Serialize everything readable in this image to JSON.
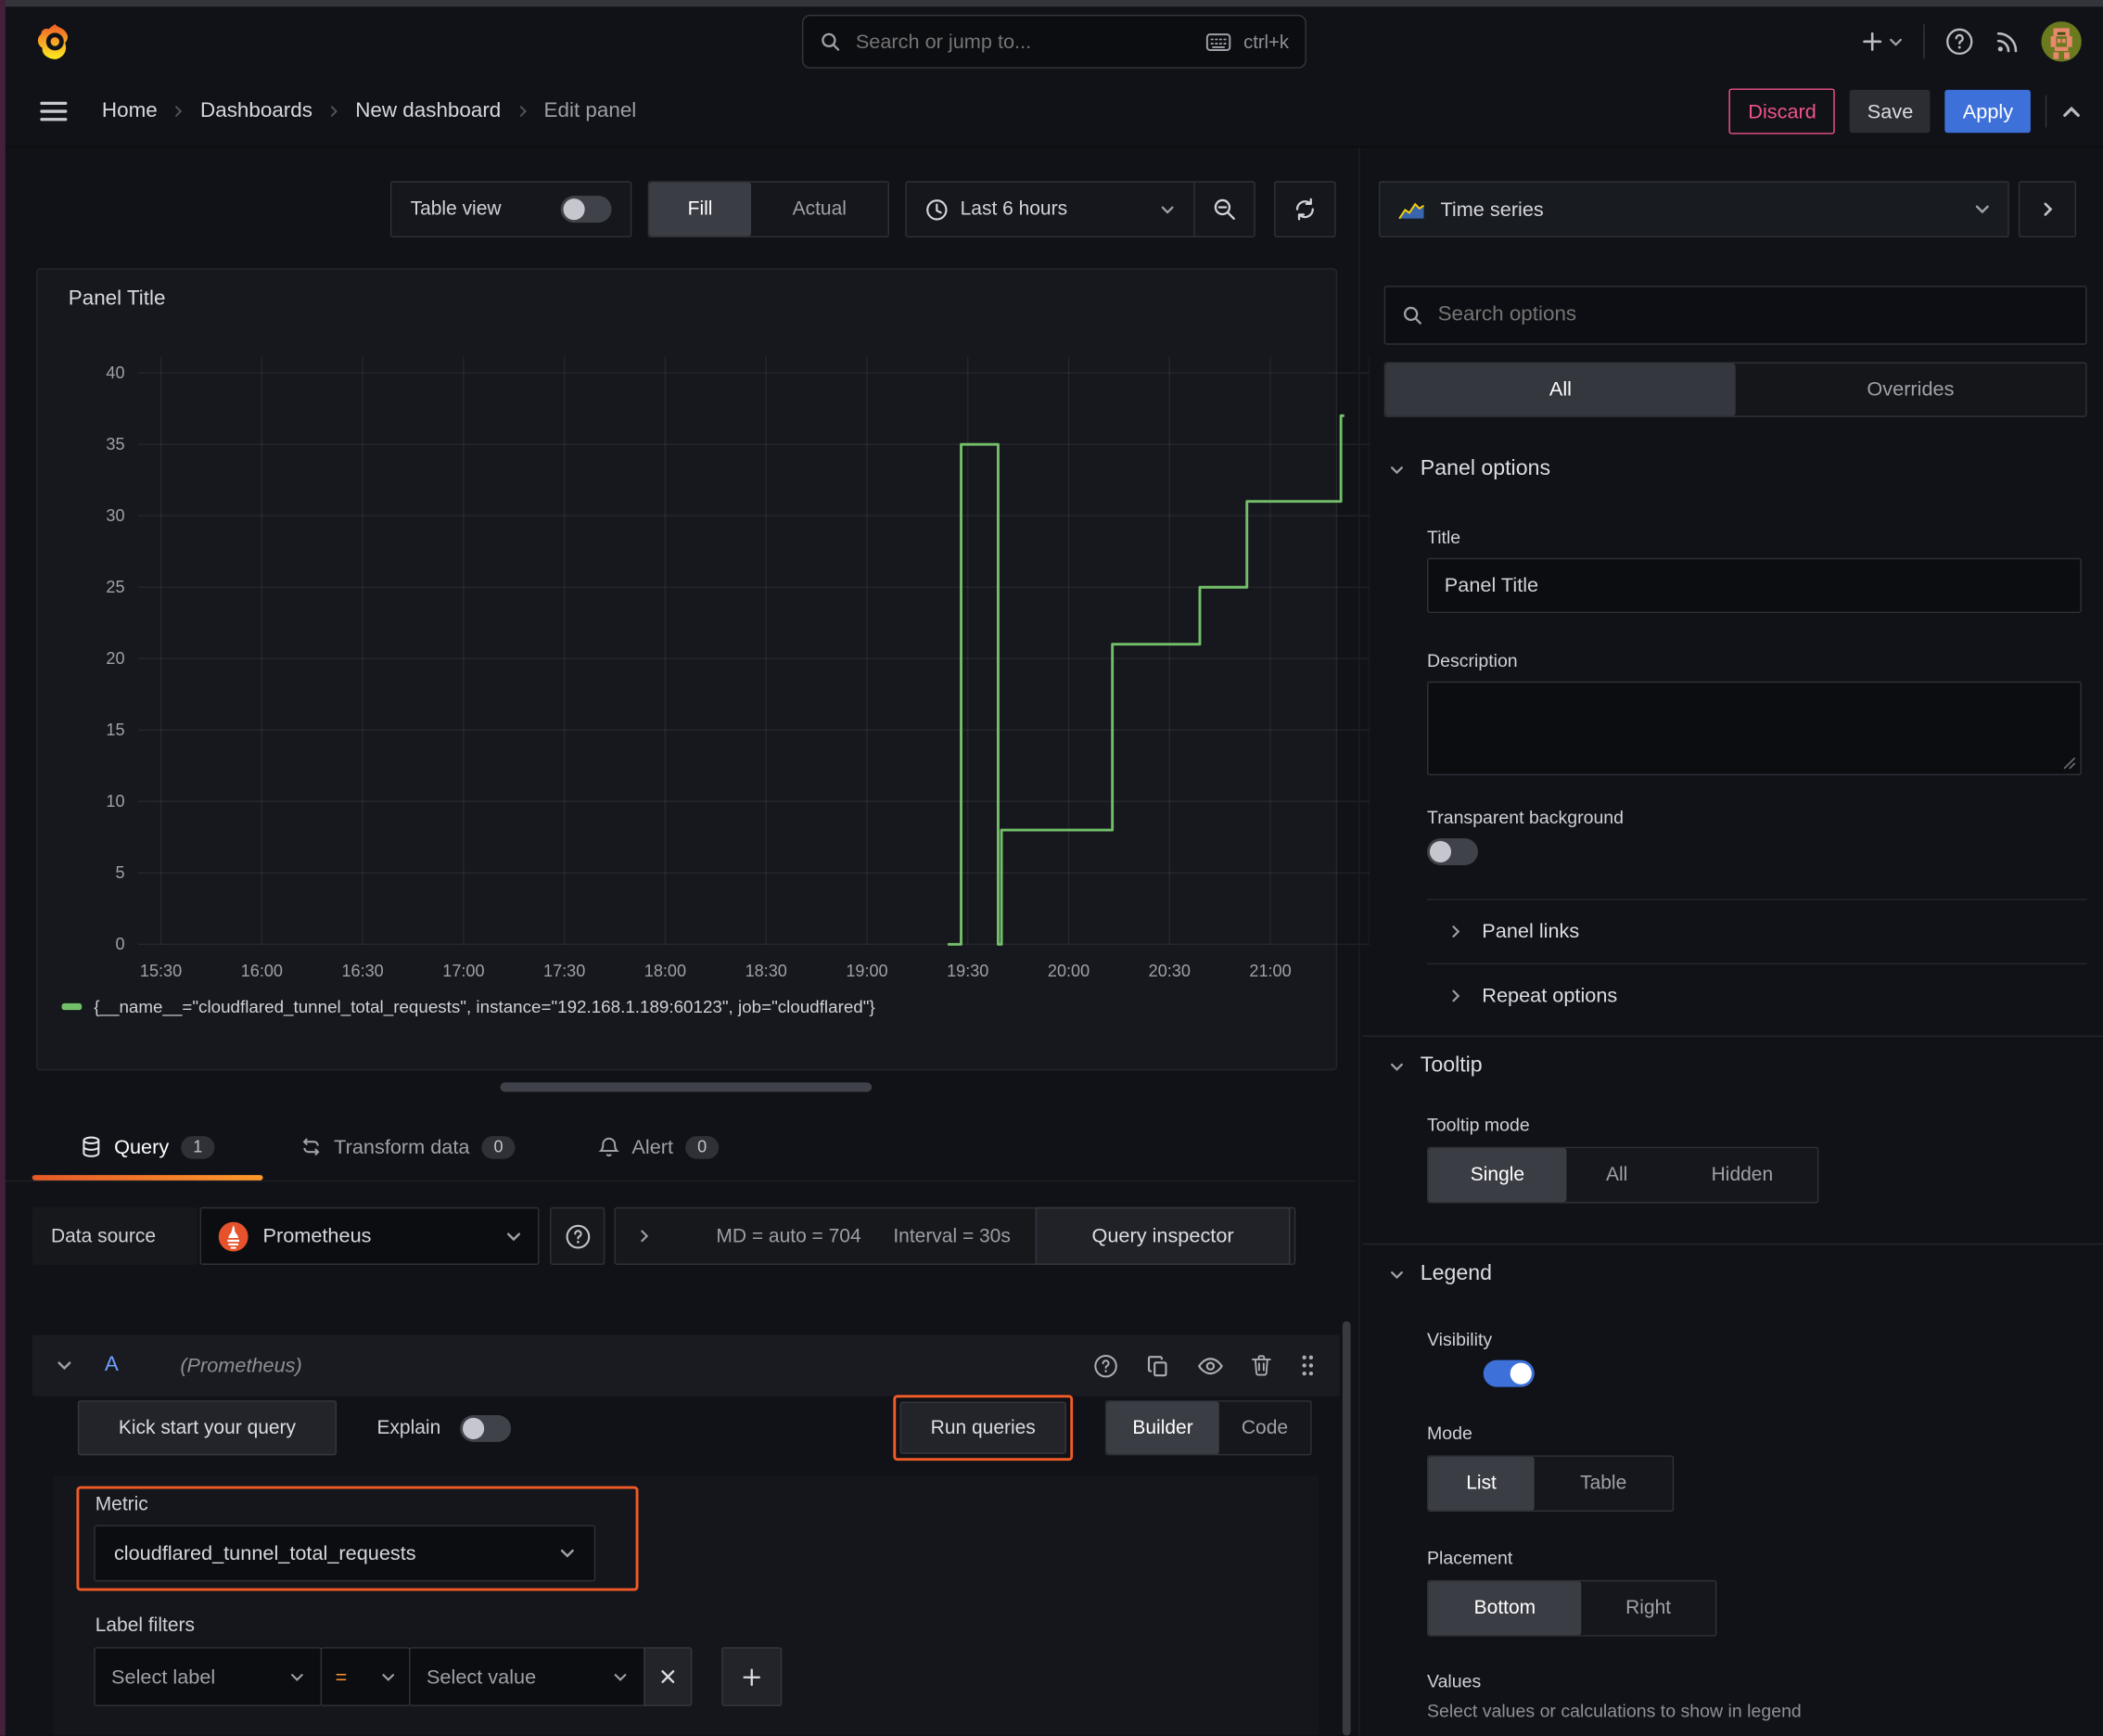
{
  "topbar": {
    "search_placeholder": "Search or jump to...",
    "shortcut": "ctrl+k"
  },
  "breadcrumb": {
    "items": [
      "Home",
      "Dashboards",
      "New dashboard",
      "Edit panel"
    ]
  },
  "actions": {
    "discard": "Discard",
    "save": "Save",
    "apply": "Apply"
  },
  "toolbar": {
    "table_view": "Table view",
    "fill": "Fill",
    "actual": "Actual",
    "time_range": "Last 6 hours"
  },
  "panel": {
    "title": "Panel Title"
  },
  "tabs": {
    "query": "Query",
    "query_count": "1",
    "transform": "Transform data",
    "transform_count": "0",
    "alert": "Alert",
    "alert_count": "0"
  },
  "datasource": {
    "label": "Data source",
    "name": "Prometheus",
    "options_summary": "MD = auto = 704",
    "interval": "Interval = 30s",
    "inspector": "Query inspector"
  },
  "query": {
    "ref_id": "A",
    "ds_hint": "(Prometheus)",
    "kick_start": "Kick start your query",
    "explain": "Explain",
    "run": "Run queries",
    "builder": "Builder",
    "code": "Code",
    "metric_label": "Metric",
    "metric": "cloudflared_tunnel_total_requests",
    "label_filters": "Label filters",
    "select_label": "Select label",
    "operator": "=",
    "select_value": "Select value"
  },
  "options": {
    "viz": "Time series",
    "search_placeholder": "Search options",
    "tab_all": "All",
    "tab_overrides": "Overrides",
    "panel_options": "Panel options",
    "title_label": "Title",
    "title_value": "Panel Title",
    "description_label": "Description",
    "transparent": "Transparent background",
    "panel_links": "Panel links",
    "repeat_options": "Repeat options",
    "tooltip": "Tooltip",
    "tooltip_mode": "Tooltip mode",
    "tooltip_single": "Single",
    "tooltip_all": "All",
    "tooltip_hidden": "Hidden",
    "legend": "Legend",
    "visibility": "Visibility",
    "mode": "Mode",
    "mode_list": "List",
    "mode_table": "Table",
    "placement": "Placement",
    "placement_bottom": "Bottom",
    "placement_right": "Right",
    "values": "Values",
    "values_desc": "Select values or calculations to show in legend"
  },
  "colors": {
    "highlight_orange": "#F15B27",
    "operator_orange": "#FF9830",
    "series_green": "#73BF69",
    "primary_blue": "#3D71D9",
    "discard_pink": "#EF5389",
    "active_tab_gradient": [
      "#E55928",
      "#FF9A2A"
    ]
  },
  "chart_data": {
    "type": "line",
    "title": "Panel Title",
    "x_axis": {
      "unit": "time of day",
      "tick_interval_min": 30,
      "ticks": [
        "15:30",
        "16:00",
        "16:30",
        "17:00",
        "17:30",
        "18:00",
        "18:30",
        "19:00",
        "19:30",
        "20:00",
        "20:30",
        "21:00"
      ]
    },
    "y_axis": {
      "min": 0,
      "max": 40,
      "ticks": [
        0,
        5,
        10,
        15,
        20,
        25,
        30,
        35,
        40
      ]
    },
    "grid": true,
    "legend_position": "bottom",
    "series": [
      {
        "name": "{__name__=\"cloudflared_tunnel_total_requests\", instance=\"192.168.1.189:60123\", job=\"cloudflared\"}",
        "color": "#73BF69",
        "points_min_after_1530": [
          [
            234,
            0
          ],
          [
            238,
            0
          ],
          [
            238,
            35
          ],
          [
            249,
            35
          ],
          [
            249,
            0
          ],
          [
            250,
            0
          ],
          [
            250,
            8
          ],
          [
            283,
            8
          ],
          [
            283,
            21
          ],
          [
            309,
            21
          ],
          [
            309,
            25
          ],
          [
            323,
            25
          ],
          [
            323,
            31
          ],
          [
            351,
            31
          ],
          [
            351,
            37
          ],
          [
            352,
            37
          ]
        ]
      }
    ]
  }
}
